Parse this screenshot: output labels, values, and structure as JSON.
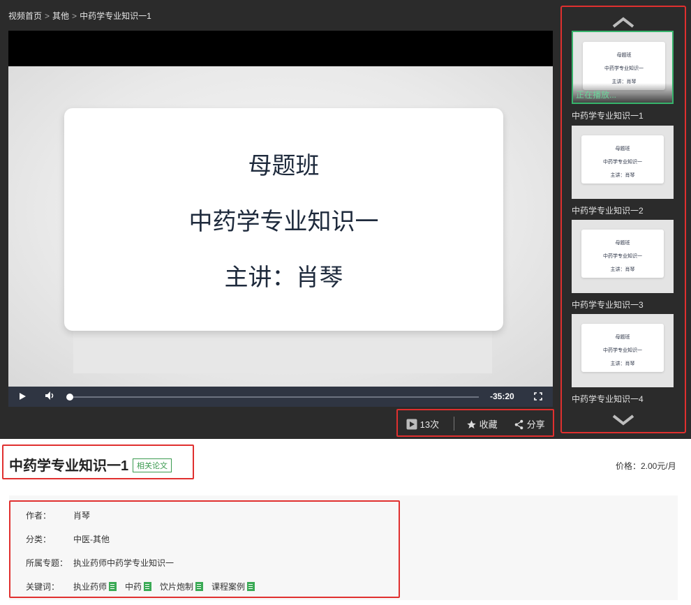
{
  "breadcrumb": {
    "home": "视频首页",
    "sep": ">",
    "category": "其他",
    "current": "中药学专业知识一1"
  },
  "player": {
    "slide_lines": [
      "母题班",
      "中药学专业知识一",
      "主讲：肖琴"
    ],
    "time_remaining": "-35:20",
    "play_icon": "play-icon",
    "volume_icon": "volume-icon",
    "fullscreen_icon": "fullscreen-icon"
  },
  "stats": {
    "views": "13次",
    "favorite": "收藏",
    "share": "分享"
  },
  "playlist": {
    "now_playing_label": "正在播放...",
    "items": [
      {
        "title": "中药学专业知识一1",
        "thumb_lines": [
          "母题班",
          "中药学专业知识一",
          "主讲：肖琴"
        ]
      },
      {
        "title": "中药学专业知识一2",
        "thumb_lines": [
          "母题班",
          "中药学专业知识一",
          "主讲：肖琴"
        ]
      },
      {
        "title": "中药学专业知识一3",
        "thumb_lines": [
          "母题班",
          "中药学专业知识一",
          "主讲：肖琴"
        ]
      },
      {
        "title": "中药学专业知识一4",
        "thumb_lines": [
          "母题班",
          "中药学专业知识一",
          "主讲：肖琴"
        ]
      }
    ]
  },
  "course": {
    "title": "中药学专业知识一1",
    "related_tag": "相关论文",
    "price": "价格：2.00元/月"
  },
  "info": {
    "author_label": "作者：",
    "author": "肖琴",
    "category_label": "分类：",
    "category": "中医-其他",
    "topic_label": "所属专题：",
    "topic": "执业药师中药学专业知识一",
    "keywords_label": "关键词：",
    "keywords": [
      "执业药师",
      "中药",
      "饮片炮制",
      "课程案例"
    ]
  },
  "colors": {
    "highlight": "#e0302f",
    "accent_green": "#3a9a4f",
    "dark_bg": "#2b2b2b"
  }
}
